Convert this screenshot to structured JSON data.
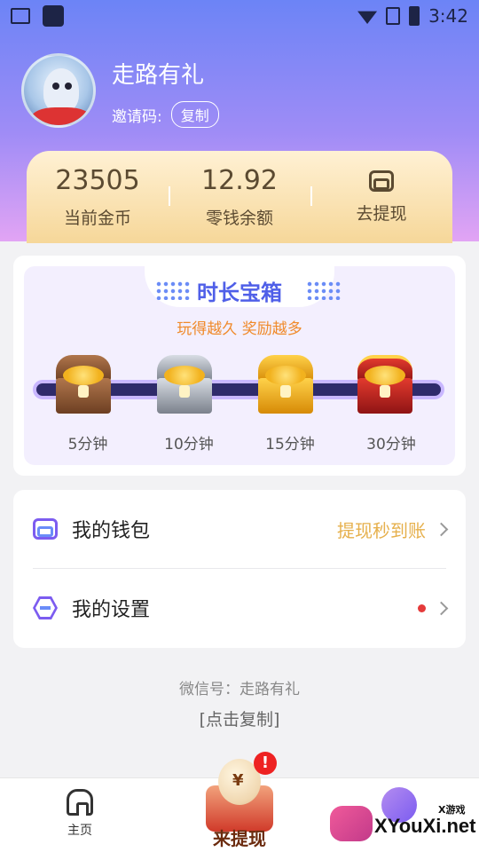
{
  "status_bar": {
    "time": "3:42"
  },
  "profile": {
    "name": "走路有礼",
    "invite_label": "邀请码:",
    "copy_label": "复制"
  },
  "stats": [
    {
      "value": "23505",
      "label": "当前金币"
    },
    {
      "value": "12.92",
      "label": "零钱余额"
    },
    {
      "label": "去提现",
      "icon": "wallet-icon"
    }
  ],
  "chest_box": {
    "title": "时长宝箱",
    "subtitle": "玩得越久 奖励越多",
    "chests": [
      {
        "label": "5分钟",
        "style": "bronze"
      },
      {
        "label": "10分钟",
        "style": "silver"
      },
      {
        "label": "15分钟",
        "style": "gold"
      },
      {
        "label": "30分钟",
        "style": "ruby"
      }
    ]
  },
  "menu": [
    {
      "label": "我的钱包",
      "hint": "提现秒到账",
      "icon": "wallet-icon"
    },
    {
      "label": "我的设置",
      "hint": "",
      "icon": "hexagon-icon",
      "has_dot": true
    }
  ],
  "footer": {
    "wechat": "微信号：走路有礼",
    "copy_link": "[点击复制]"
  },
  "tabbar": {
    "home_label": "主页",
    "withdraw_label": "来提现"
  },
  "watermark": {
    "small": "X游戏",
    "text": "XYouXi.net"
  },
  "colors": {
    "header_top": "#6c84f6",
    "header_bottom": "#e2a4f4",
    "accent": "#7c5cf0",
    "hint": "#e6b04c"
  }
}
